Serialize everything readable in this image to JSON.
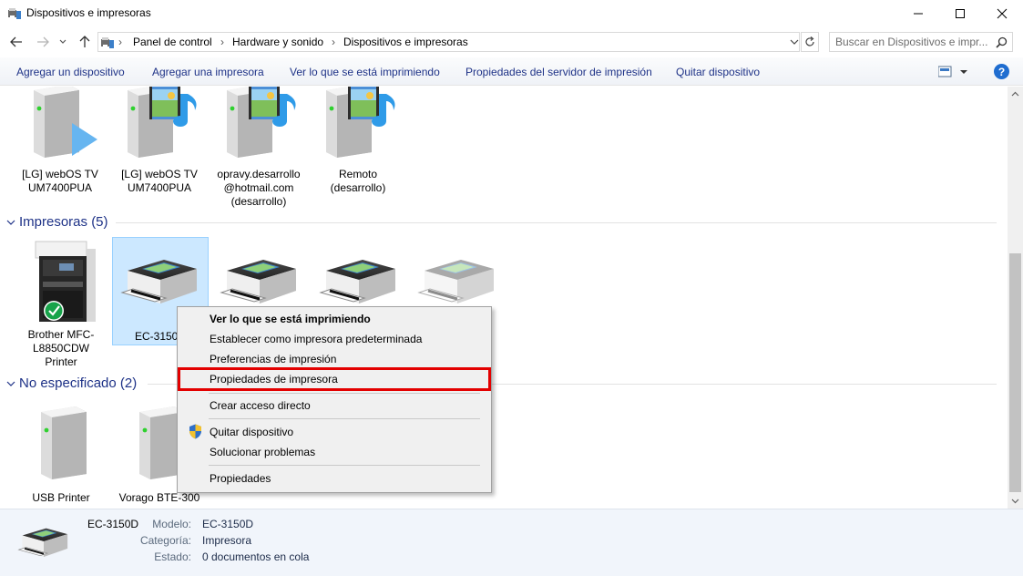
{
  "window": {
    "title": "Dispositivos e impresoras"
  },
  "address": {
    "crumbs": [
      "Panel de control",
      "Hardware y sonido",
      "Dispositivos e impresoras"
    ],
    "search_placeholder": "Buscar en Dispositivos e impr..."
  },
  "toolbar": {
    "items": [
      "Agregar un dispositivo",
      "Agregar una impresora",
      "Ver lo que se está imprimiendo",
      "Propiedades del servidor de impresión",
      "Quitar dispositivo"
    ],
    "help": "?"
  },
  "media_devices": [
    {
      "label": "[LG] webOS TV UM7400PUA"
    },
    {
      "label": "[LG] webOS TV UM7400PUA"
    },
    {
      "label": "opravy.desarrollo @hotmail.com (desarrollo)"
    },
    {
      "label": "Remoto (desarrollo)"
    }
  ],
  "groups": {
    "printers": {
      "title": "Impresoras (5)",
      "items": [
        {
          "label": "Brother MFC-L8850CDW Printer",
          "default": true
        },
        {
          "label": "EC-3150D",
          "selected": true
        },
        {
          "label": ""
        },
        {
          "label": ""
        },
        {
          "label": ""
        }
      ]
    },
    "unspecified": {
      "title": "No especificado (2)",
      "items": [
        {
          "label": "USB Printer"
        },
        {
          "label": "Vorago BTE-300"
        }
      ]
    }
  },
  "context_menu": {
    "items": [
      {
        "label": "Ver lo que se está imprimiendo",
        "bold": true
      },
      {
        "label": "Establecer como impresora predeterminada"
      },
      {
        "label": "Preferencias de impresión"
      },
      {
        "label": "Propiedades de impresora",
        "highlighted": true
      },
      {
        "label": "Crear acceso directo"
      },
      {
        "label": "Quitar dispositivo",
        "icon": "shield-icon"
      },
      {
        "label": "Solucionar problemas"
      },
      {
        "label": "Propiedades"
      }
    ]
  },
  "details": {
    "name": "EC-3150D",
    "fields": [
      {
        "key": "Modelo:",
        "value": "EC-3150D"
      },
      {
        "key": "Categoría:",
        "value": "Impresora"
      },
      {
        "key": "Estado:",
        "value": "0 documentos en cola"
      }
    ]
  },
  "colors": {
    "link_blue": "#1e3287",
    "highlight_red": "#e30000",
    "selection": "#cce8ff"
  }
}
